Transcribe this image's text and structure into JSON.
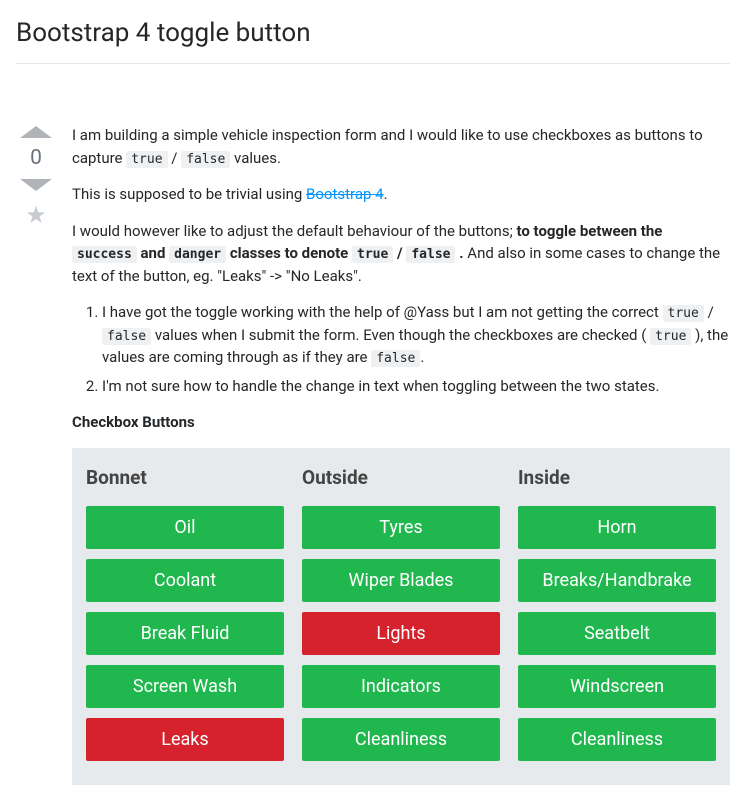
{
  "title": "Bootstrap 4 toggle button",
  "vote_count": "0",
  "para1_a": "I am building a simple vehicle inspection form and I would like to use checkboxes as buttons to capture ",
  "code_true": "true",
  "slash": " / ",
  "code_false": "false",
  "para1_b": " values.",
  "para2_a": "This is supposed to be trivial using ",
  "bs_link": "Bootstrap 4",
  "para2_b": ".",
  "para3_a": "I would however like to adjust the default behaviour of the buttons; ",
  "para3_bold_a": "to toggle between the ",
  "code_success": "success",
  "para3_bold_b": " and ",
  "code_danger": "danger",
  "para3_bold_c": " classes to denote ",
  "para3_bold_d": " .",
  "para3_b": " And also in some cases to change the text of the button, eg. \"Leaks\" -> \"No Leaks\".",
  "li1_a": "I have got the toggle working with the help of @Yass but I am not getting the correct ",
  "li1_b": " values when I submit the form. Even though the checkboxes are checked ( ",
  "li1_c": " ), the values are coming through as if they are ",
  "li1_d": ".",
  "li2": "I'm not sure how to handle the change in text when toggling between the two states.",
  "section_label": "Checkbox Buttons",
  "columns": [
    {
      "title": "Bonnet",
      "buttons": [
        {
          "label": "Oil",
          "state": "success"
        },
        {
          "label": "Coolant",
          "state": "success"
        },
        {
          "label": "Break Fluid",
          "state": "success"
        },
        {
          "label": "Screen Wash",
          "state": "success"
        },
        {
          "label": "Leaks",
          "state": "danger"
        }
      ]
    },
    {
      "title": "Outside",
      "buttons": [
        {
          "label": "Tyres",
          "state": "success"
        },
        {
          "label": "Wiper Blades",
          "state": "success"
        },
        {
          "label": "Lights",
          "state": "danger"
        },
        {
          "label": "Indicators",
          "state": "success"
        },
        {
          "label": "Cleanliness",
          "state": "success"
        }
      ]
    },
    {
      "title": "Inside",
      "buttons": [
        {
          "label": "Horn",
          "state": "success"
        },
        {
          "label": "Breaks/Handbrake",
          "state": "success"
        },
        {
          "label": "Seatbelt",
          "state": "success"
        },
        {
          "label": "Windscreen",
          "state": "success"
        },
        {
          "label": "Cleanliness",
          "state": "success"
        }
      ]
    }
  ]
}
